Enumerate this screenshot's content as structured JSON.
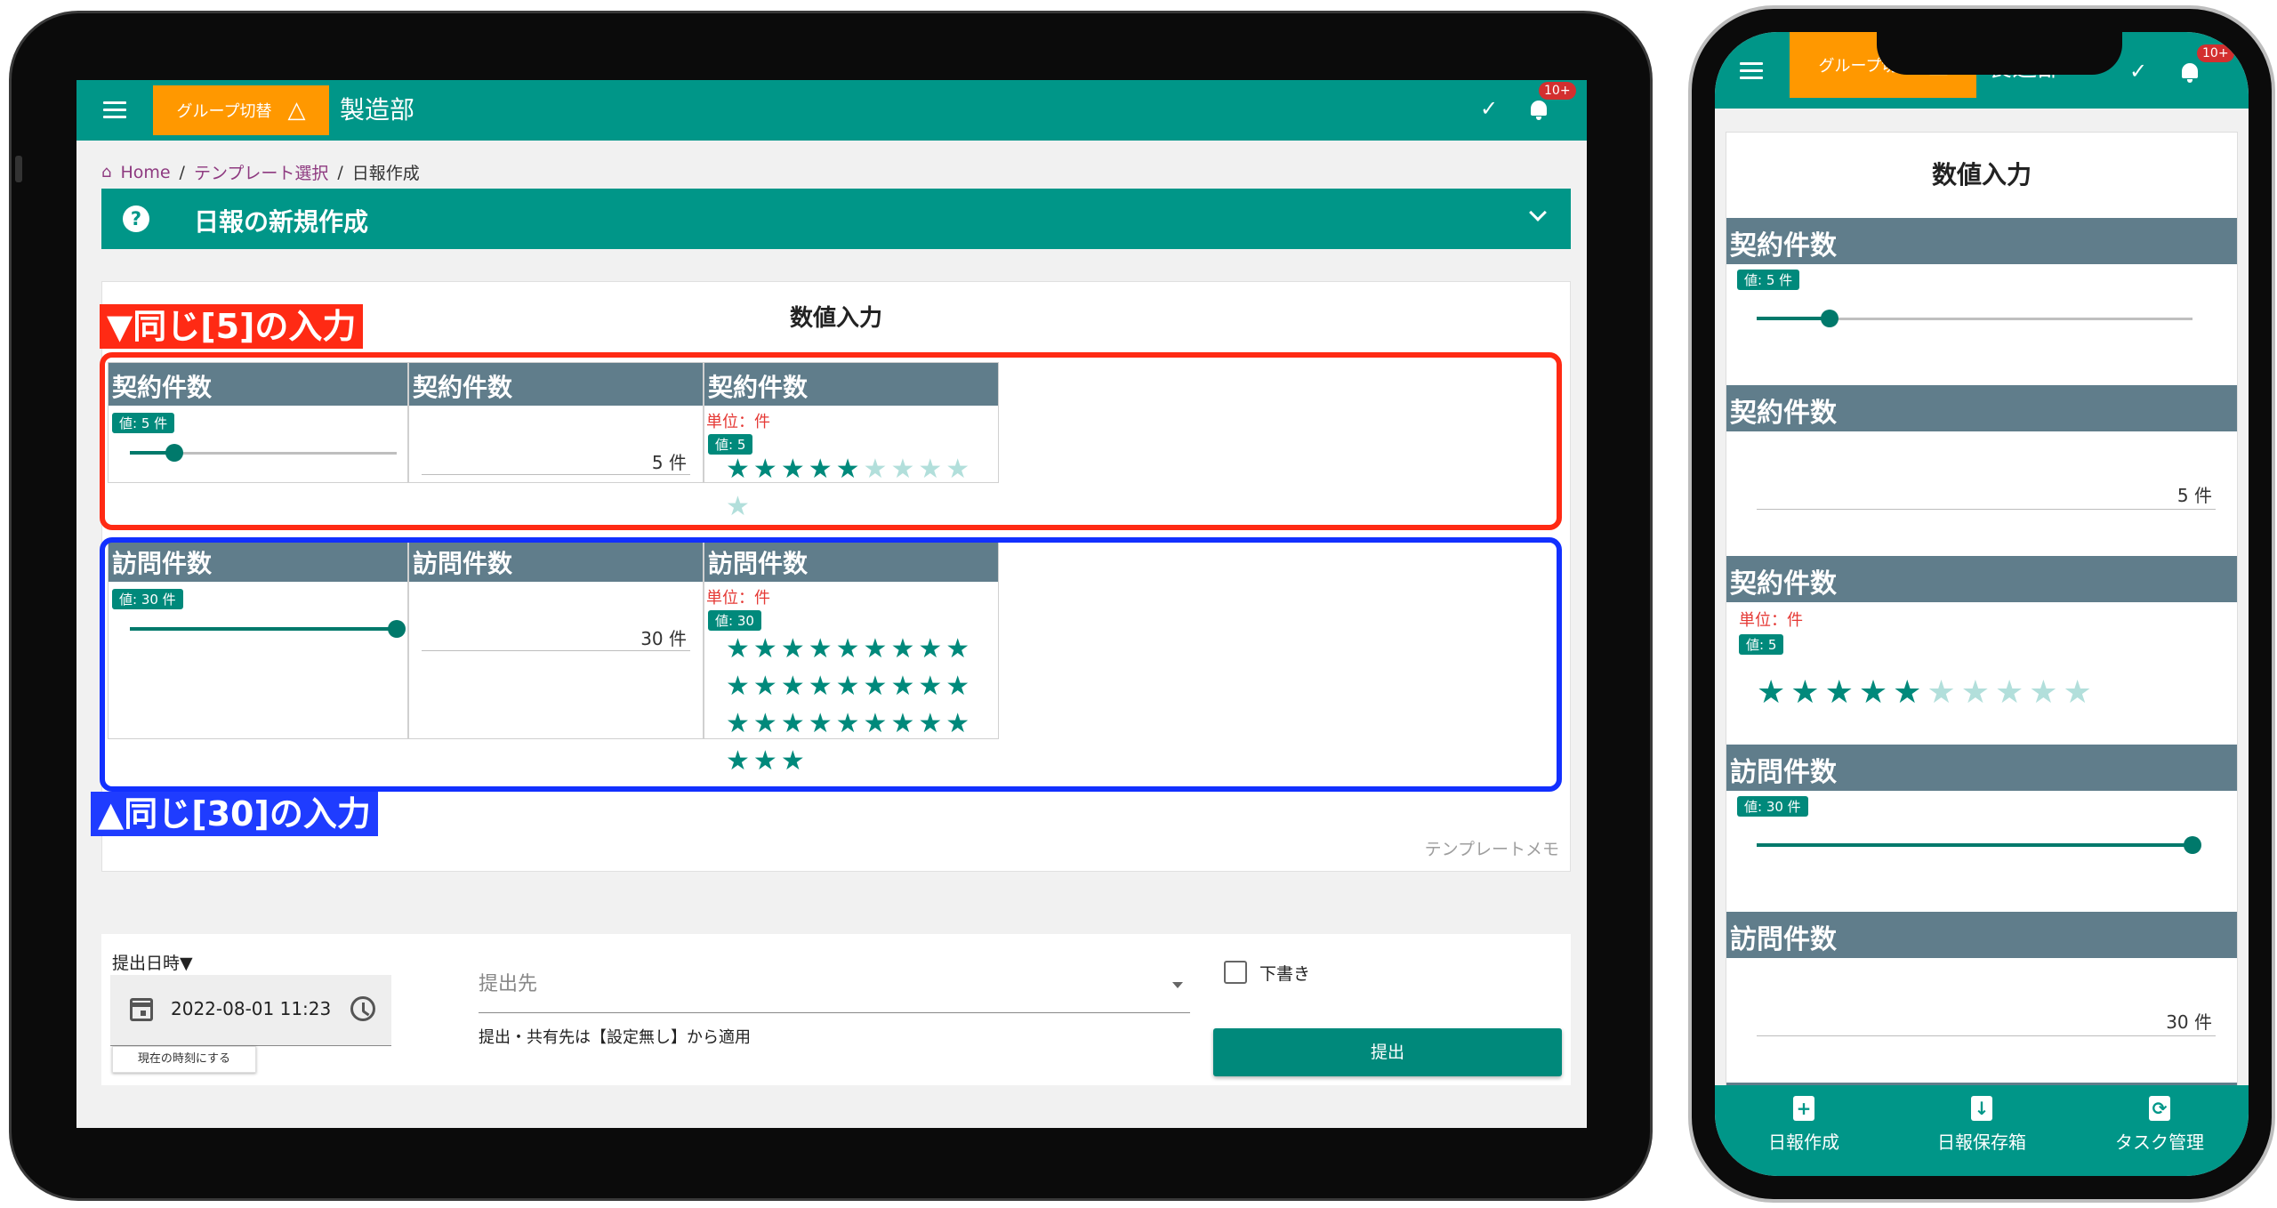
{
  "appbar": {
    "group_switch": "グループ切替",
    "warning_glyph": "△",
    "department": "製造部",
    "badge": "10+"
  },
  "breadcrumb": {
    "home": "Home",
    "separator": "/",
    "template_select": "テンプレート選択",
    "current": "日報作成"
  },
  "page_title": "日報の新規作成",
  "section_title": "数値入力",
  "annotations": {
    "same5": "▼同じ[5]の入力",
    "same30": "▲同じ[30]の入力"
  },
  "rows": [
    {
      "label": "契約件数",
      "slider_chip": "値: 5 件",
      "slider_value": 5,
      "slider_max": 30,
      "number_value": "5 件",
      "unit_label": "単位：件",
      "star_chip": "値: 5",
      "stars_filled": 5,
      "stars_total": 10
    },
    {
      "label": "訪問件数",
      "slider_chip": "値: 30 件",
      "slider_value": 30,
      "slider_max": 30,
      "number_value": "30 件",
      "unit_label": "単位：件",
      "star_chip": "値: 30",
      "stars_filled": 30,
      "stars_total": 30
    }
  ],
  "template_memo": "テンプレートメモ",
  "submit": {
    "date_label": "提出日時▼",
    "date_value": "2022-08-01 11:23",
    "now_button": "現在の時刻にする",
    "destination_label": "提出先",
    "destination_hint": "提出・共有先は【設定無し】から適用",
    "draft_label": "下書き",
    "submit_button": "提出"
  },
  "phone": {
    "bottom_nav": [
      {
        "label": "日報作成",
        "icon": "+"
      },
      {
        "label": "日報保存箱",
        "icon": "↓"
      },
      {
        "label": "タスク管理",
        "icon": "⟳"
      }
    ]
  },
  "colors": {
    "primary": "#009688",
    "accent": "#ff9800",
    "header_grey": "#607d8b",
    "red_annotation": "#ff2a14",
    "blue_annotation": "#1f3cff"
  }
}
